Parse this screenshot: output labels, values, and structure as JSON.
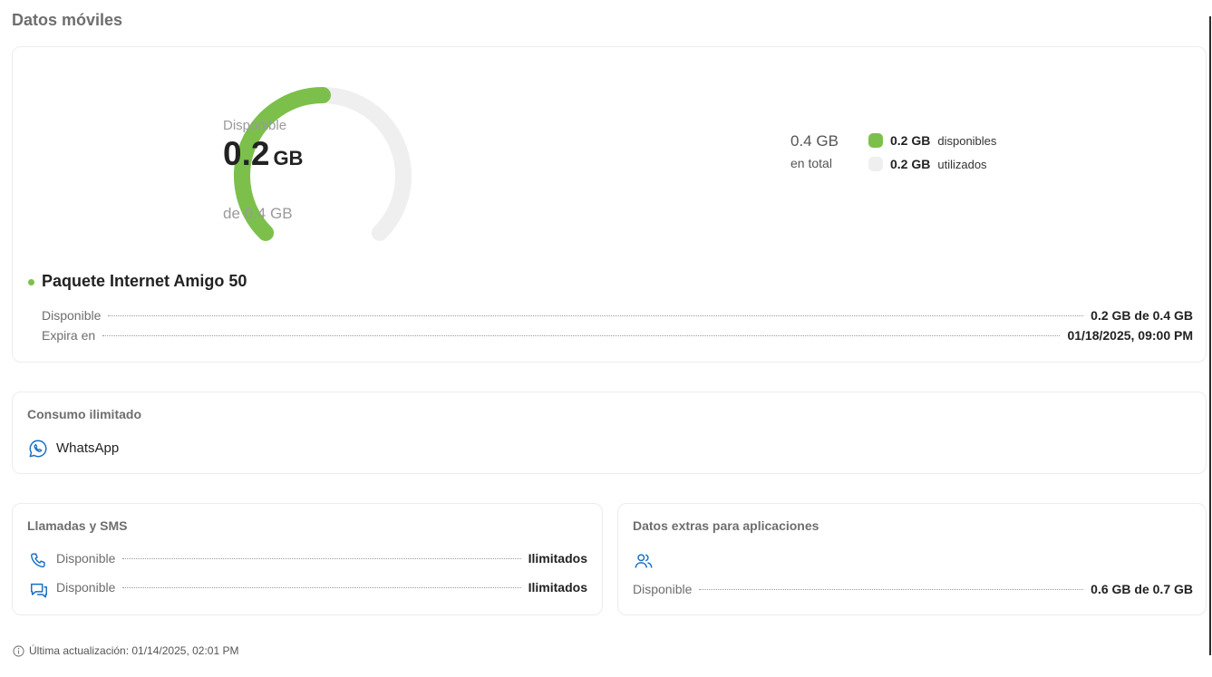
{
  "page_title": "Datos móviles",
  "gauge": {
    "label": "Disponible",
    "value": "0.2",
    "unit": "GB",
    "subtitle": "de 0.4 GB",
    "fraction_available": 0.5,
    "color_available": "#7cc04b",
    "color_used": "#efefef"
  },
  "summary": {
    "total_value": "0.4 GB",
    "total_label": "en total",
    "legend": [
      {
        "value": "0.2 GB",
        "label": "disponibles",
        "color": "#7cc04b"
      },
      {
        "value": "0.2 GB",
        "label": "utilizados",
        "color": "#efefef"
      }
    ]
  },
  "plan": {
    "name": "Paquete Internet Amigo 50",
    "rows": [
      {
        "label": "Disponible",
        "value": "0.2 GB de 0.4 GB"
      },
      {
        "label": "Expira en",
        "value": "01/18/2025, 09:00 PM"
      }
    ]
  },
  "unlimited": {
    "title": "Consumo ilimitado",
    "items": [
      {
        "icon": "whatsapp-icon",
        "label": "WhatsApp"
      }
    ]
  },
  "calls": {
    "title": "Llamadas y SMS",
    "rows": [
      {
        "icon": "phone-icon",
        "label": "Disponible",
        "value": "Ilimitados"
      },
      {
        "icon": "chat-icon",
        "label": "Disponible",
        "value": "Ilimitados"
      }
    ]
  },
  "extras": {
    "title": "Datos extras para aplicaciones",
    "icon": "people-icon",
    "row": {
      "label": "Disponible",
      "value": "0.6 GB de 0.7 GB"
    }
  },
  "footer": {
    "text": "Última actualización: 01/14/2025, 02:01 PM",
    "icon": "info-icon"
  },
  "colors": {
    "accent": "#7cc04b",
    "icon_blue": "#1a6fc4"
  }
}
